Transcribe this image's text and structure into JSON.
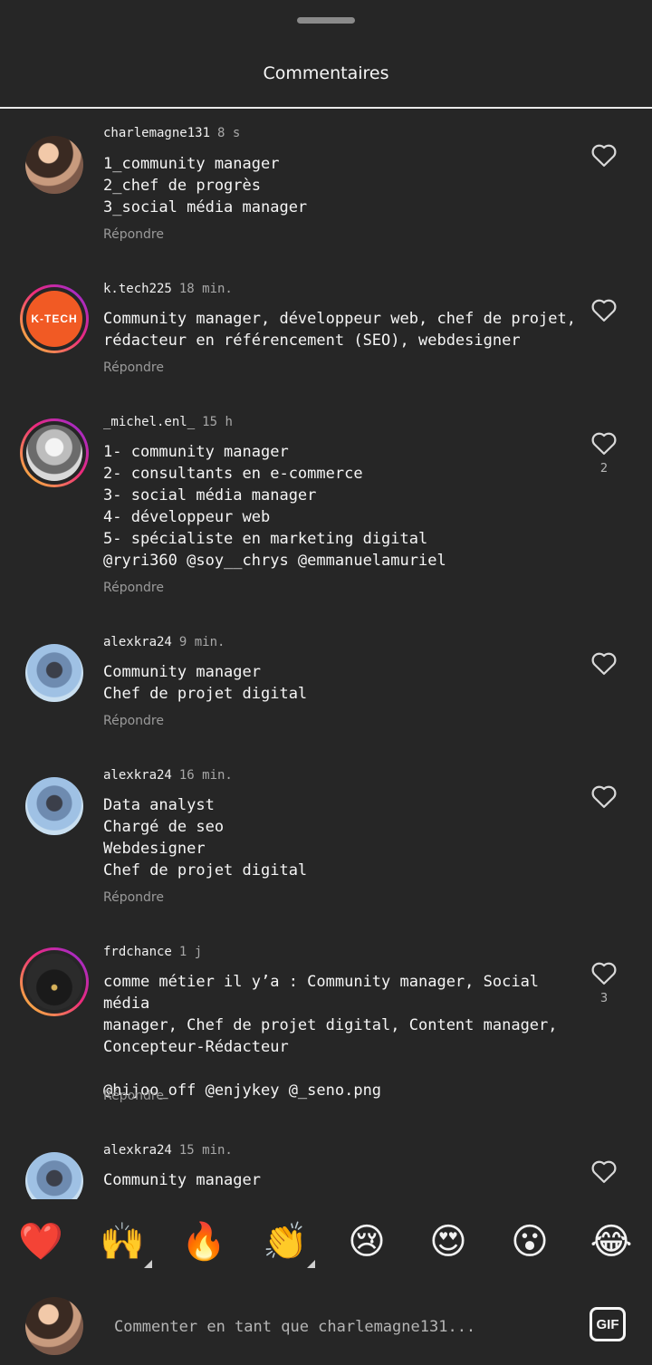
{
  "sheet": {
    "title": "Commentaires"
  },
  "comments": [
    {
      "username": "charlemagne131",
      "time": "8 s",
      "text": "1_community manager\n2_chef de progrès\n3_social média manager",
      "reply_label": "Répondre",
      "likes": ""
    },
    {
      "username": "k.tech225",
      "time": "18 min.",
      "text": "Community manager, développeur web, chef de projet,\nrédacteur en référencement (SEO), webdesigner",
      "reply_label": "Répondre",
      "likes": "",
      "avatar_text": "K-TECH"
    },
    {
      "username": "_michel.enl_",
      "time": "15 h",
      "text": "1- community manager\n2- consultants en e-commerce\n3- social média manager\n4- développeur web\n5- spécialiste en marketing digital\n@ryri360 @soy__chrys @emmanuelamuriel",
      "reply_label": "Répondre",
      "likes": "2"
    },
    {
      "username": "alexkra24",
      "time": "9 min.",
      "text": "Community manager\nChef de projet digital",
      "reply_label": "Répondre",
      "likes": ""
    },
    {
      "username": "alexkra24",
      "time": "16 min.",
      "text": "Data analyst\nChargé de seo\nWebdesigner\nChef de projet digital",
      "reply_label": "Répondre",
      "likes": ""
    },
    {
      "username": "frdchance",
      "time": "1 j",
      "text": "comme métier il y’a : Community manager, Social média\nmanager, Chef de projet digital, Content manager,\nConcepteur-Rédacteur\n\n@hijoo_off @enjykey @_seno.png",
      "reply_label": "Répondre",
      "likes": "3"
    },
    {
      "username": "alexkra24",
      "time": "15 min.",
      "text": "Community manager",
      "reply_label": "",
      "likes": ""
    }
  ],
  "reactions": [
    "❤️",
    "🙌",
    "🔥",
    "👏",
    "😢",
    "😍",
    "😮",
    "😂"
  ],
  "composer": {
    "placeholder": "Commenter en tant que charlemagne131...",
    "gif_label": "GIF"
  },
  "icons": {
    "like": "heart-outline-icon",
    "gif": "gif-icon"
  },
  "colors": {
    "background": "#262626",
    "story_ring_start": "#f9ce34",
    "story_ring_end": "#8a2be2",
    "heart": "#ff3040"
  }
}
